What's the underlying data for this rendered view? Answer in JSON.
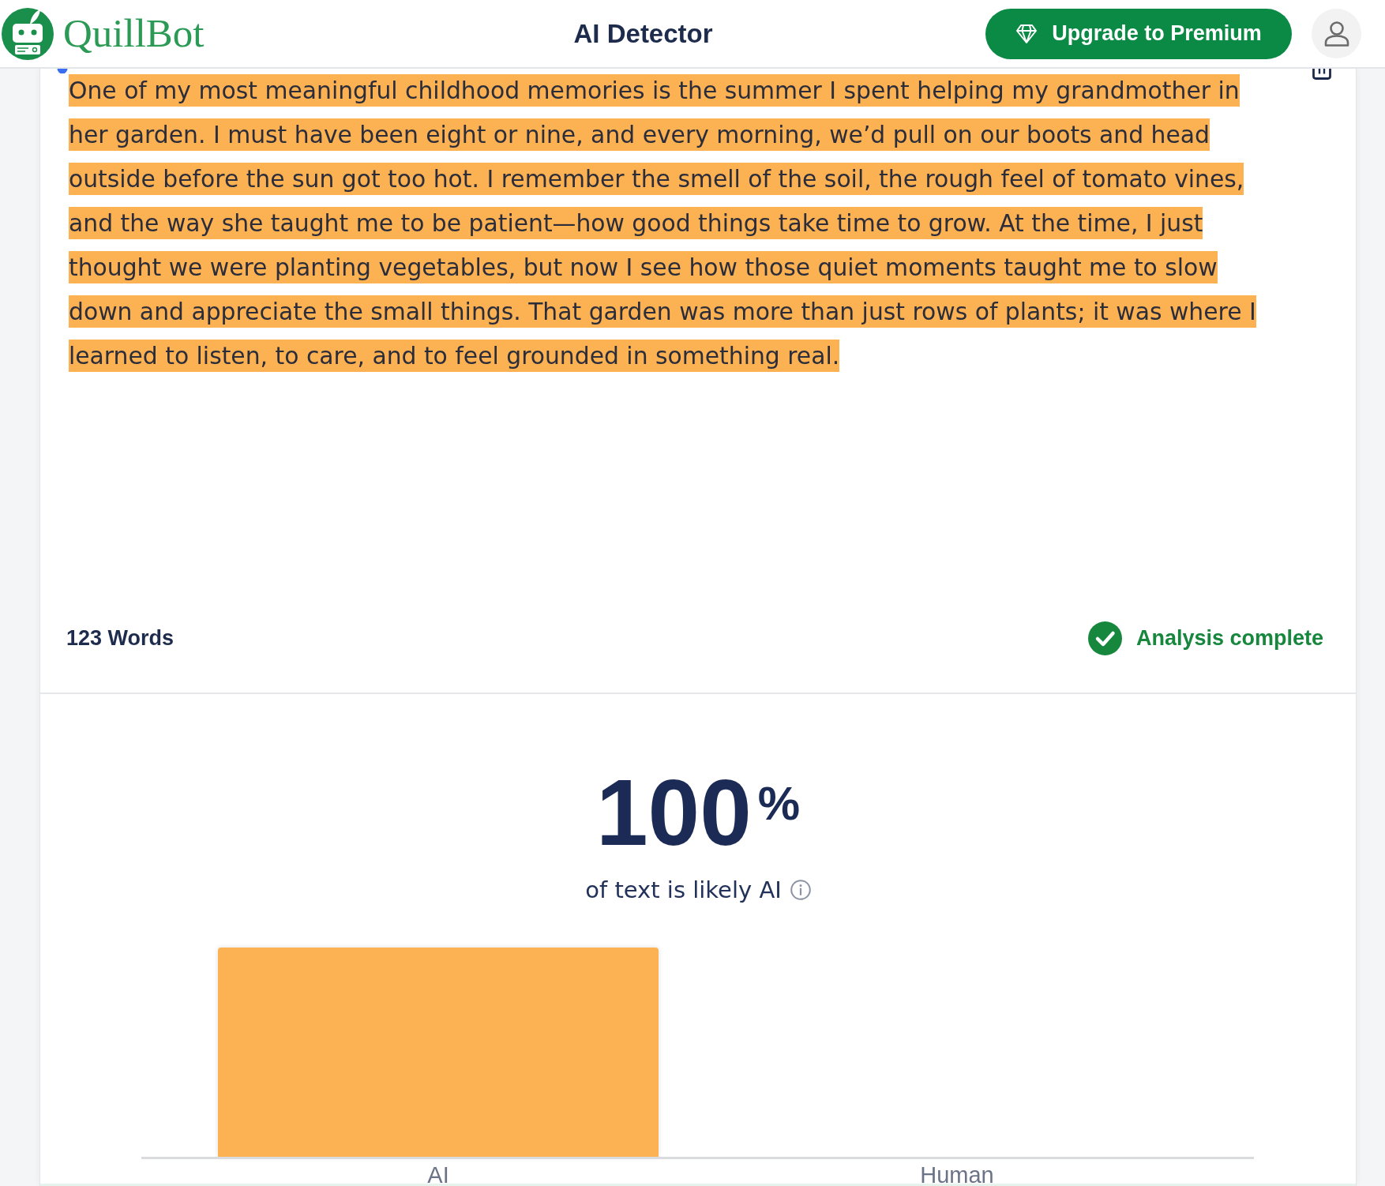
{
  "header": {
    "logo_text": "QuillBot",
    "title": "AI Detector",
    "upgrade_button": "Upgrade to Premium"
  },
  "editor": {
    "text": "One of my most meaningful childhood memories is the summer I spent helping my grandmother in her garden. I must have been eight or nine, and every morning, we’d pull on our boots and head outside before the sun got too hot. I remember the smell of the soil, the rough feel of tomato vines, and the way she taught me to be patient—how good things take time to grow. At the time, I just thought we were planting vegetables, but now I see how those quiet moments taught me to slow down and appreciate the small things. That garden was more than just rows of plants; it was where I learned to listen, to care, and to feel grounded in something real.",
    "highlighted": true,
    "word_count": "123 Words",
    "status": {
      "text": "Analysis complete",
      "done": true
    }
  },
  "result": {
    "score": "100$^{%}$",
    "caption": "of text is likely AI",
    "chart": {
      "categories": [
        "AI",
        "Human"
      ]
    }
  }
}
